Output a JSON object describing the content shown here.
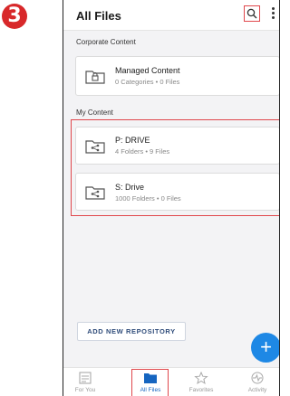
{
  "step_number": "3",
  "appbar": {
    "title": "All Files",
    "search_icon": "search-icon",
    "more_icon": "more-vert-icon"
  },
  "sections": {
    "corporate": "Corporate Content",
    "my_content": "My Content"
  },
  "repositories": [
    {
      "name": "Managed Content",
      "meta": "0 Categories • 0 Files",
      "icon": "lock-folder-icon"
    },
    {
      "name": "P: DRIVE",
      "meta": "4 Folders • 9 Files",
      "icon": "shared-folder-icon"
    },
    {
      "name": "S: Drive",
      "meta": "1000 Folders • 0 Files",
      "icon": "shared-folder-icon"
    }
  ],
  "add_repository_label": "ADD NEW REPOSITORY",
  "fab_label": "+",
  "tabs": [
    {
      "label": "For You",
      "icon": "for-you-icon"
    },
    {
      "label": "All Files",
      "icon": "folder-icon",
      "active": true
    },
    {
      "label": "Favorites",
      "icon": "star-icon"
    },
    {
      "label": "Activity",
      "icon": "activity-icon"
    }
  ],
  "colors": {
    "accent": "#1e88e5",
    "highlight": "#e0474c",
    "badge": "#d8282a",
    "active_tab": "#1565c0"
  }
}
